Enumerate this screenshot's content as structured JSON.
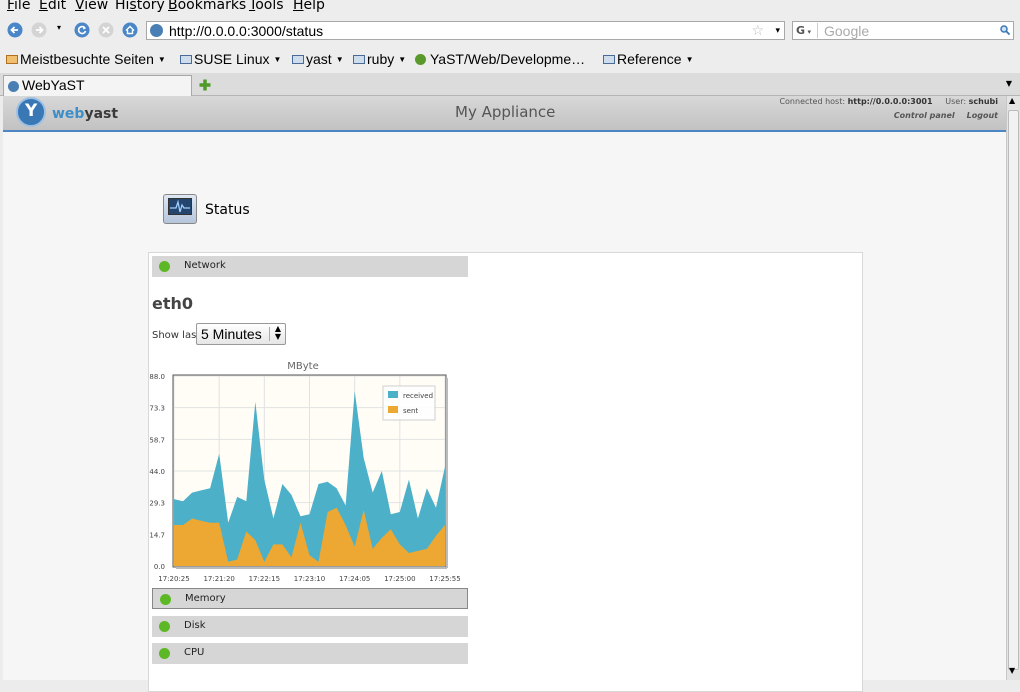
{
  "menu": [
    "File",
    "Edit",
    "View",
    "History",
    "Bookmarks",
    "Tools",
    "Help"
  ],
  "menu_mnemonic": [
    "F",
    "E",
    "V",
    "s",
    "B",
    "T",
    "H"
  ],
  "nav": {
    "url": "http://0.0.0.0:3000/status",
    "search_placeholder": "Google",
    "search_engine": "G"
  },
  "bookmarks": [
    {
      "label": "Meistbesuchte Seiten",
      "type": "smart"
    },
    {
      "label": "SUSE Linux",
      "type": "folder"
    },
    {
      "label": "yast",
      "type": "folder"
    },
    {
      "label": "ruby",
      "type": "folder"
    },
    {
      "label": "YaST/Web/Developme…",
      "type": "page"
    },
    {
      "label": "Reference",
      "type": "folder"
    }
  ],
  "tabs": [
    {
      "label": "WebYaST"
    }
  ],
  "header": {
    "logo_web": "web",
    "logo_yast": "yast",
    "logo_glyph": "Y",
    "app_name": "My Appliance",
    "host_label": "Connected host:",
    "host": "http://0.0.0.0:3001",
    "user_label": "User:",
    "user": "schubi",
    "control_panel": "Control panel",
    "logout": "Logout"
  },
  "page": {
    "title": "Status",
    "sections": [
      {
        "label": "Network",
        "status": "ok"
      },
      {
        "label": "Memory",
        "status": "ok"
      },
      {
        "label": "Disk",
        "status": "ok"
      },
      {
        "label": "CPU",
        "status": "ok"
      }
    ],
    "interface": "eth0",
    "show_last_label": "Show last",
    "show_last_value": "5 Minutes"
  },
  "colors": {
    "received": "#4bb0c8",
    "sent": "#eda733",
    "status_ok": "#5cb825",
    "accent": "#4d86c4"
  },
  "chart_data": {
    "type": "area",
    "title": "MByte",
    "x_ticks": [
      "17:20:25",
      "17:21:20",
      "17:22:15",
      "17:23:10",
      "17:24:05",
      "17:25:00",
      "17:25:55"
    ],
    "y_ticks": [
      "0.0",
      "14.7",
      "29.3",
      "44.0",
      "58.7",
      "73.3",
      "88.0"
    ],
    "ylim": [
      0,
      88
    ],
    "legend_position": "top-right",
    "grid": true,
    "x": [
      "17:20:25",
      "17:20:36",
      "17:20:47",
      "17:20:58",
      "17:21:09",
      "17:21:20",
      "17:21:31",
      "17:21:42",
      "17:21:53",
      "17:22:04",
      "17:22:15",
      "17:22:26",
      "17:22:37",
      "17:22:48",
      "17:22:59",
      "17:23:10",
      "17:23:21",
      "17:23:32",
      "17:23:43",
      "17:23:54",
      "17:24:05",
      "17:24:16",
      "17:24:27",
      "17:24:38",
      "17:24:49",
      "17:25:00",
      "17:25:11",
      "17:25:22",
      "17:25:33",
      "17:25:44",
      "17:25:55"
    ],
    "series": [
      {
        "name": "received",
        "values": [
          31,
          30,
          34,
          35,
          36,
          52,
          20,
          32,
          30,
          76,
          40,
          22,
          38,
          33,
          23,
          24,
          38,
          39,
          36,
          28,
          81,
          50,
          34,
          44,
          24,
          25,
          40,
          22,
          36,
          27,
          46
        ]
      },
      {
        "name": "sent",
        "values": [
          19,
          19,
          22,
          21,
          20,
          20,
          2,
          3,
          16,
          12,
          2,
          10,
          10,
          4,
          20,
          5,
          2,
          25,
          27,
          19,
          9,
          26,
          8,
          13,
          17,
          10,
          6,
          7,
          8,
          14,
          19
        ]
      }
    ]
  }
}
